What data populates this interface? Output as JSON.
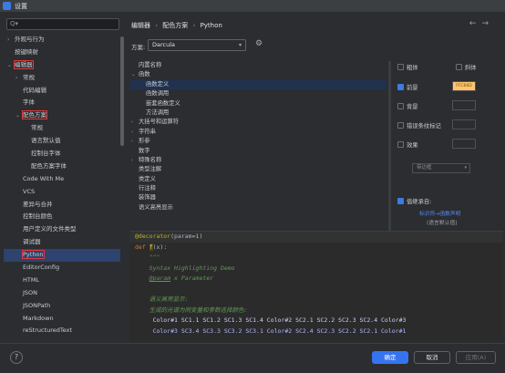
{
  "window": {
    "title": "设置"
  },
  "sidebar": {
    "search_placeholder": "Q▾",
    "items": [
      {
        "label": "外观与行为",
        "arrow": "›"
      },
      {
        "label": "按键映射",
        "arrow": ""
      },
      {
        "label": "编辑器",
        "arrow": "⌄"
      },
      {
        "label": "常规",
        "arrow": "›"
      },
      {
        "label": "代码编辑",
        "arrow": ""
      },
      {
        "label": "字体",
        "arrow": ""
      },
      {
        "label": "配色方案",
        "arrow": "⌄"
      },
      {
        "label": "常规",
        "arrow": ""
      },
      {
        "label": "语言默认值",
        "arrow": ""
      },
      {
        "label": "控制台字体",
        "arrow": ""
      },
      {
        "label": "配色方案字体",
        "arrow": ""
      },
      {
        "label": "Code With Me",
        "arrow": ""
      },
      {
        "label": "VCS",
        "arrow": ""
      },
      {
        "label": "差异与合并",
        "arrow": ""
      },
      {
        "label": "控制台颜色",
        "arrow": ""
      },
      {
        "label": "用户定义的文件类型",
        "arrow": ""
      },
      {
        "label": "调试器",
        "arrow": ""
      },
      {
        "label": "Python",
        "arrow": ""
      },
      {
        "label": "EditorConfig",
        "arrow": ""
      },
      {
        "label": "HTML",
        "arrow": ""
      },
      {
        "label": "JSON",
        "arrow": ""
      },
      {
        "label": "JSONPath",
        "arrow": ""
      },
      {
        "label": "Markdown",
        "arrow": ""
      },
      {
        "label": "reStructuredText",
        "arrow": ""
      }
    ]
  },
  "breadcrumb": {
    "part1": "编辑器",
    "sep1": "›",
    "part2": "配色方案",
    "sep2": "›",
    "part3": "Python"
  },
  "nav": {
    "back": "←",
    "forward": "→"
  },
  "scheme": {
    "label": "方案:",
    "value": "Darcula",
    "caret": "▾"
  },
  "attributes": [
    {
      "label": "内置名称",
      "arrow": "",
      "indent": 1
    },
    {
      "label": "函数",
      "arrow": "⌄",
      "indent": 0
    },
    {
      "label": "函数定义",
      "arrow": "",
      "indent": 2
    },
    {
      "label": "函数调用",
      "arrow": "",
      "indent": 2
    },
    {
      "label": "嵌套函数定义",
      "arrow": "",
      "indent": 2
    },
    {
      "label": "方法调用",
      "arrow": "",
      "indent": 2
    },
    {
      "label": "大括号和运算符",
      "arrow": "›",
      "indent": 0
    },
    {
      "label": "字符串",
      "arrow": "›",
      "indent": 0
    },
    {
      "label": "形参",
      "arrow": "›",
      "indent": 0
    },
    {
      "label": "数字",
      "arrow": "",
      "indent": 1
    },
    {
      "label": "特殊名称",
      "arrow": "›",
      "indent": 0
    },
    {
      "label": "类型注解",
      "arrow": "",
      "indent": 1
    },
    {
      "label": "类定义",
      "arrow": "",
      "indent": 1
    },
    {
      "label": "行注释",
      "arrow": "",
      "indent": 1
    },
    {
      "label": "装饰器",
      "arrow": "",
      "indent": 1
    },
    {
      "label": "语义高亮显示",
      "arrow": "",
      "indent": 1
    }
  ],
  "props": {
    "bold": "粗体",
    "italic": "斜体",
    "foreground": "前景",
    "foreground_value": "FFC66D",
    "background": "背景",
    "error_stripe": "错误条纹标记",
    "effects": "效果",
    "effect_type": "带边框",
    "effect_caret": "▾",
    "inherit": "值继承自:",
    "inherit_link": "标识符→函数声明",
    "inherit_sub": "(语言默认值)"
  },
  "preview": {
    "l1_at": "@decorator",
    "l1_rest": "(param=1)",
    "l2_kw": "def",
    "l2_fn": "f",
    "l2_rest": "(x):",
    "l3": "    \"\"\"",
    "l4": "    Syntax Highlighting Demo",
    "l5_tag": "@param",
    "l5_rest": " x Parameter",
    "l7": "    语义高亮显示:",
    "l8": "    生成的光谱为同变量和参数选择颜色:",
    "l9": "     Color#1 SC1.1 SC1.2 SC1.3 SC1.4 Color#2 SC2.1 SC2.2 SC2.3 SC2.4 Color#3",
    "l10": "     Color#3 SC3.4 SC3.3 SC3.2 SC3.1 Color#2 SC2.4 SC2.3 SC2.2 SC2.1 Color#1"
  },
  "footer": {
    "help": "?",
    "ok": "确定",
    "cancel": "取消",
    "apply": "应用(A)"
  },
  "colors": {
    "accent": "#3574f0",
    "selection": "#2e436e",
    "highlight_box": "#e03a3a"
  }
}
